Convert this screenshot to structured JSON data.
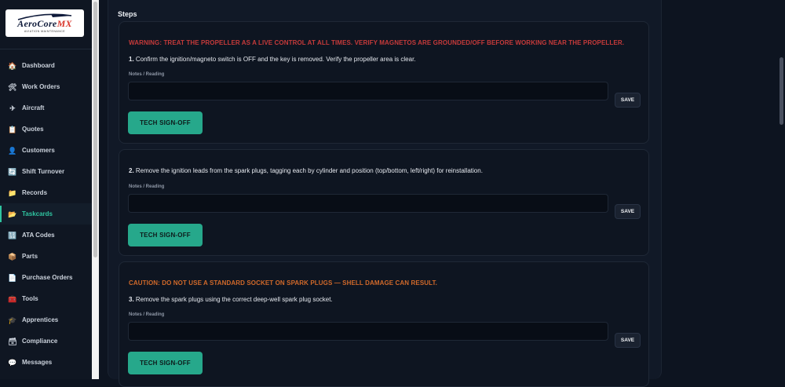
{
  "brand": {
    "name_main": "AeroCore",
    "name_accent": "MX",
    "tagline": "AVIATION MAINTENANCE",
    "accent_color": "#d9362b"
  },
  "sidebar": {
    "items": [
      {
        "label": "Dashboard",
        "icon": "house-icon",
        "glyph": "🏠",
        "active": false
      },
      {
        "label": "Work Orders",
        "icon": "tools-icon",
        "glyph": "🛠",
        "active": false
      },
      {
        "label": "Aircraft",
        "icon": "airplane-icon",
        "glyph": "✈",
        "active": false
      },
      {
        "label": "Quotes",
        "icon": "clipboard-icon",
        "glyph": "📋",
        "active": false
      },
      {
        "label": "Customers",
        "icon": "person-icon",
        "glyph": "👤",
        "active": false
      },
      {
        "label": "Shift Turnover",
        "icon": "refresh-icon",
        "glyph": "🔄",
        "active": false
      },
      {
        "label": "Records",
        "icon": "folder-icon",
        "glyph": "📁",
        "active": false
      },
      {
        "label": "Taskcards",
        "icon": "folder-open-icon",
        "glyph": "📂",
        "active": true
      },
      {
        "label": "ATA Codes",
        "icon": "numbers-icon",
        "glyph": "🔢",
        "active": false
      },
      {
        "label": "Parts",
        "icon": "package-icon",
        "glyph": "📦",
        "active": false
      },
      {
        "label": "Purchase Orders",
        "icon": "document-icon",
        "glyph": "📄",
        "active": false
      },
      {
        "label": "Tools",
        "icon": "toolbox-icon",
        "glyph": "🧰",
        "active": false
      },
      {
        "label": "Apprentices",
        "icon": "graduation-cap-icon",
        "glyph": "🎓",
        "active": false
      },
      {
        "label": "Compliance",
        "icon": "box-icon",
        "glyph": "🗃",
        "active": false
      },
      {
        "label": "Messages",
        "icon": "chat-bubble-icon",
        "glyph": "💬",
        "active": false
      }
    ],
    "active_color": "#2fc4a0"
  },
  "main": {
    "title": "Steps",
    "notes_label": "Notes / Reading",
    "save_label": "SAVE",
    "signoff_label": "TECH SIGN-OFF",
    "signoff_color": "#26a88b",
    "steps": [
      {
        "warning": "WARNING: TREAT THE PROPELLER AS A LIVE CONTROL AT ALL TIMES. VERIFY MAGNETOS ARE GROUNDED/OFF BEFORE WORKING NEAR THE PROPELLER.",
        "warning_color": "#c63a3a",
        "number": "1.",
        "text": "Confirm the ignition/magneto switch is OFF and the key is removed. Verify the propeller area is clear.",
        "note_value": ""
      },
      {
        "warning": "",
        "number": "2.",
        "text": "Remove the ignition leads from the spark plugs, tagging each by cylinder and position (top/bottom, left/right) for reinstallation.",
        "note_value": ""
      },
      {
        "warning": "CAUTION: DO NOT USE A STANDARD SOCKET ON SPARK PLUGS — SHELL DAMAGE CAN RESULT.",
        "warning_color": "#d1692a",
        "number": "3.",
        "text": "Remove the spark plugs using the correct deep-well spark plug socket.",
        "note_value": ""
      }
    ]
  }
}
